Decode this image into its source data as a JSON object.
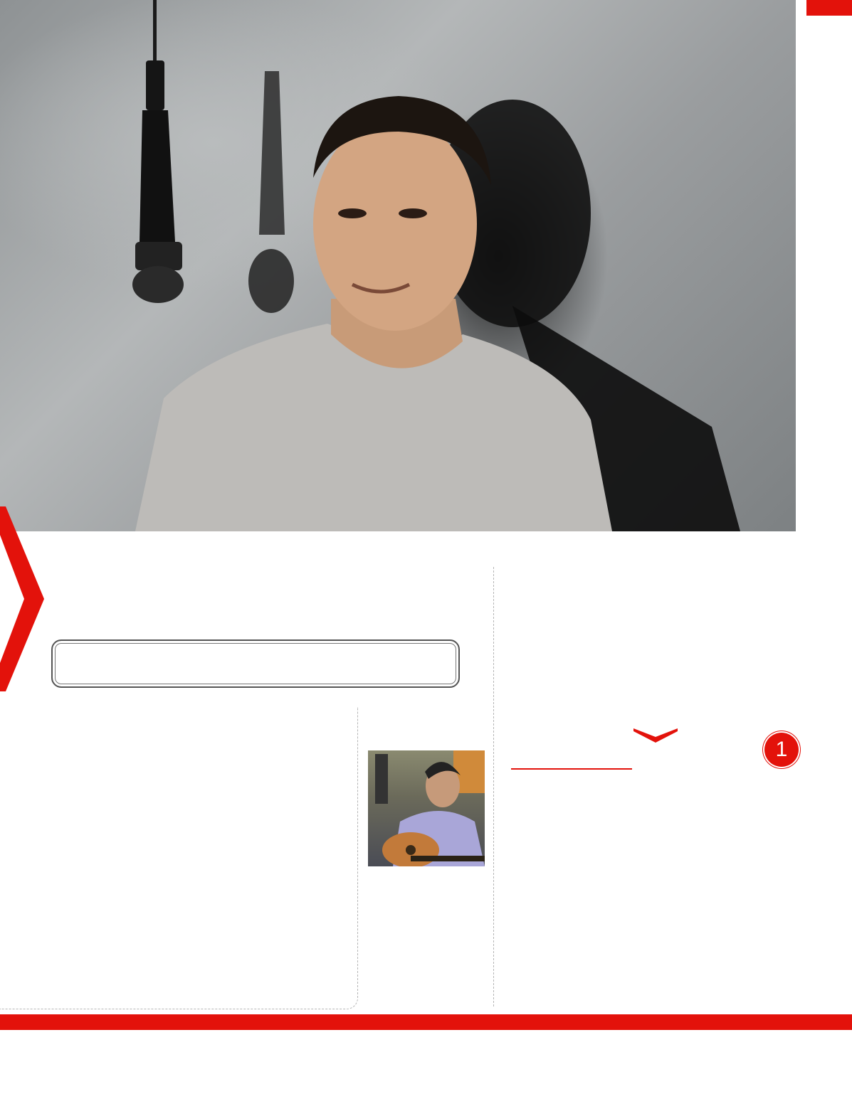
{
  "page": {
    "accent_color": "#e3120b",
    "hero_photo": "portrait-with-hanging-microphone",
    "inset_photo": "man-playing-acoustic-guitar",
    "badge_number": "1",
    "icons": [
      "chevron-right-icon",
      "chevron-down-icon"
    ]
  }
}
